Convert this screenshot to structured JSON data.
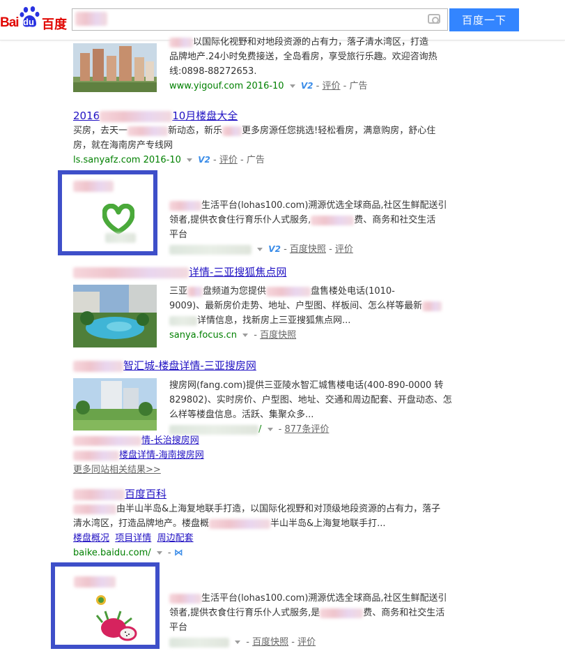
{
  "header": {
    "logo_bai": "Bai",
    "logo_du": "du",
    "logo_cn": "百度",
    "search_button": "百度一下"
  },
  "result1": {
    "desc_line1": "以国际化视野和对地段资源的占有力，落子清水湾区，打造",
    "desc_line2": "品牌地产.24小时免费接送，全岛看房，享受旅行乐趣。欢迎咨询热",
    "desc_line3": "线:0898-88272653.",
    "url": "www.yigouf.com",
    "date": "2016-10",
    "v2": "V2",
    "comment": "评价",
    "sep": "-",
    "ad": "广告"
  },
  "result2": {
    "title_a": "2016",
    "title_b": "10月楼盘大全",
    "desc_a": "买房，去天一",
    "desc_b": "新动态，新乐",
    "desc_c": "更多房源任您挑选!轻松看房，满意购房，舒心住",
    "desc_line2": "房，就在海南房产专线网",
    "url": "ls.sanyafz.com",
    "date": "2016-10",
    "v2": "V2",
    "comment": "评价",
    "sep": "-",
    "ad": "广告"
  },
  "result3": {
    "desc_line1": "生活平台(lohas100.com)溯源优选全球商品,社区生鲜配送引",
    "desc_line2a": "领者,提供衣食住行育乐仆人式服务,",
    "desc_line2b": "费、商务和社交生活",
    "desc_line3": "平台",
    "v2": "V2",
    "snapshot": "百度快照",
    "comment": "评价",
    "sep": "-"
  },
  "result4": {
    "title": "详情-三亚搜狐焦点网",
    "desc_a": "三亚",
    "desc_b": "盘频道为您提供",
    "desc_c": "盘售楼处电话(1010-",
    "desc_line2": "9009)、最新房价走势、地址、户型图、样板间、怎么样等最新",
    "desc_line3": "详情信息，找新房上三亚搜狐焦点网...",
    "url": "sanya.focus.cn",
    "snapshot": "百度快照",
    "sep": "-"
  },
  "result5": {
    "title": "智汇城-楼盘详情-三亚搜房网",
    "desc_line1": "搜房网(fang.com)提供三亚陵水智汇城售楼电话(400-890-0000 转",
    "desc_line2": "829802)、实时房价、户型图、地址、交通和周边配套、开盘动态、怎",
    "desc_line3": "么样等楼盘信息。活跃、集聚众多...",
    "url_tail": "/",
    "comments": "877条评价",
    "sep": "-",
    "sub1": "情-长治搜房网",
    "sub2": "楼盘详情-海南搜房网",
    "more": "更多同站相关结果>>"
  },
  "result6": {
    "title": "百度百科",
    "desc_line1": "由半山半岛&上海复地联手打造，以国际化视野和对顶级地段资源的占有力，落子",
    "desc_line2a": "清水湾区，打造品牌地产。楼盘概",
    "desc_line2b": "半山半岛&上海复地联手打...",
    "link1": "楼盘概况",
    "link2": "项目详情",
    "link3": "周边配套",
    "url": "baike.baidu.com/",
    "sep": "-"
  },
  "result7": {
    "desc_line1": "生活平台(lohas100.com)溯源优选全球商品,社区生鲜配送引",
    "desc_line2a": "领者,提供衣食住行育乐仆人式服务,是",
    "desc_line2b": "费、商务和社交生活",
    "desc_line3": "平台",
    "snapshot": "百度快照",
    "comment": "评价",
    "sep": "-"
  }
}
